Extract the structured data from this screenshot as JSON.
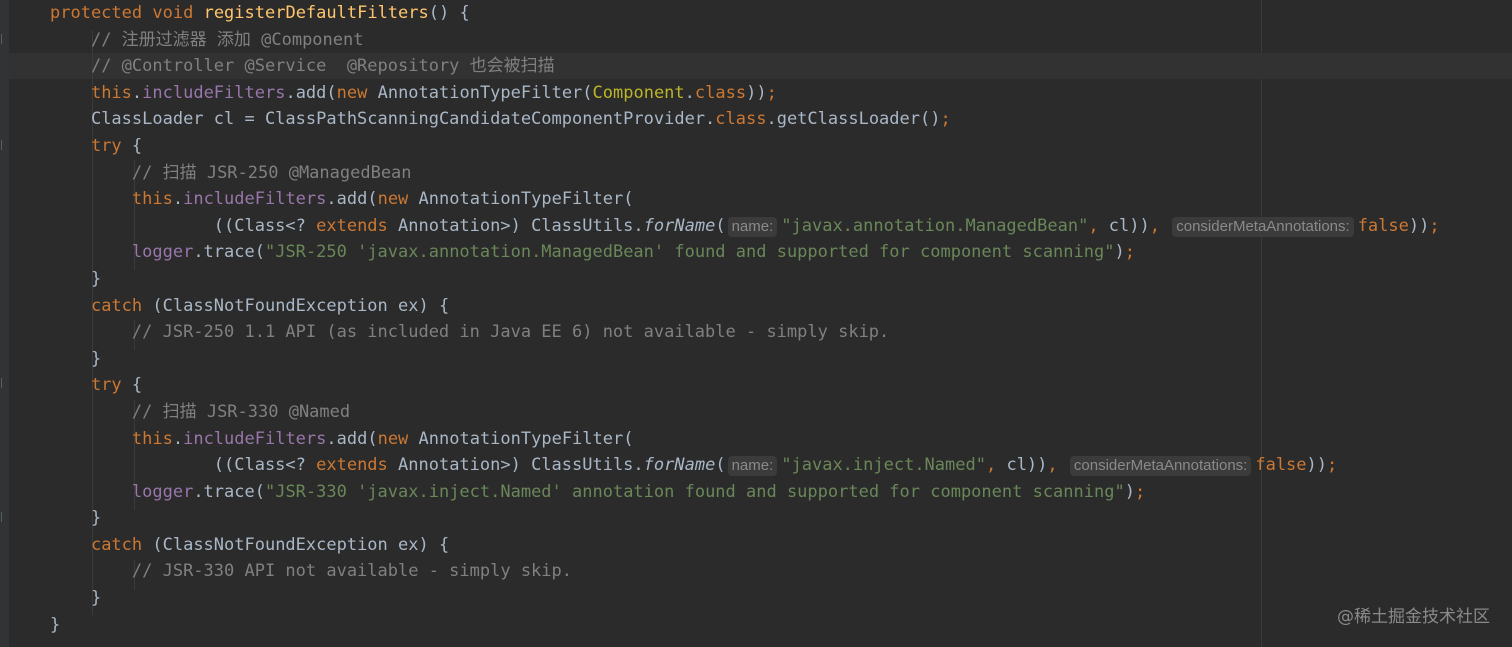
{
  "editor": {
    "method_signature": {
      "modifier": "protected",
      "return_type": "void",
      "name": "registerDefaultFilters",
      "open": "() {"
    },
    "comment1": "// 注册过滤器 添加 @Component",
    "comment2": "// @Controller @Service  @Repository 也会被扫描",
    "line4": {
      "this_kw": "this",
      "dot1": ".",
      "field": "includeFilters",
      "call": ".add(",
      "new_kw": "new",
      "ctor": " AnnotationTypeFilter(",
      "annot": "Component",
      "dot2": ".",
      "class_kw": "class",
      "close": "))",
      "semi": ";"
    },
    "line5": {
      "start": "ClassLoader cl = ClassPathScanningCandidateComponentProvider.",
      "class_kw": "class",
      "end": ".getClassLoader()",
      "semi": ";"
    },
    "try1": {
      "try_kw": "try",
      "brace": " {",
      "comment": "// 扫描 JSR-250 @ManagedBean",
      "this_kw": "this",
      "dot": ".",
      "field": "includeFilters",
      "call": ".add(",
      "new_kw": "new",
      "ctor": " AnnotationTypeFilter(",
      "cast_open": "((Class<? ",
      "extends_kw": "extends",
      "cast_close": " Annotation>) ClassUtils.",
      "for_name": "forName",
      "paren": "(",
      "hint_name": "name:",
      "string_arg": "\"javax.annotation.ManagedBean\"",
      "comma": ",",
      "cl_close": " cl))",
      "comma2": ",",
      "hint_meta": "considerMetaAnnotations:",
      "false_kw": "false",
      "end": "))",
      "semi": ";",
      "logger": "logger",
      "trace": ".trace(",
      "log_string": "\"JSR-250 'javax.annotation.ManagedBean' found and supported for component scanning\"",
      "log_end": ")",
      "log_semi": ";",
      "close": "}"
    },
    "catch1": {
      "catch_kw": "catch",
      "rest": " (ClassNotFoundException ex) {",
      "comment": "// JSR-250 1.1 API (as included in Java EE 6) not available - simply skip.",
      "close": "}"
    },
    "try2": {
      "try_kw": "try",
      "brace": " {",
      "comment": "// 扫描 JSR-330 @Named",
      "this_kw": "this",
      "dot": ".",
      "field": "includeFilters",
      "call": ".add(",
      "new_kw": "new",
      "ctor": " AnnotationTypeFilter(",
      "cast_open": "((Class<? ",
      "extends_kw": "extends",
      "cast_close": " Annotation>) ClassUtils.",
      "for_name": "forName",
      "paren": "(",
      "hint_name": "name:",
      "string_arg": "\"javax.inject.Named\"",
      "comma": ",",
      "cl_close": " cl))",
      "comma2": ",",
      "hint_meta": "considerMetaAnnotations:",
      "false_kw": "false",
      "end": "))",
      "semi": ";",
      "logger": "logger",
      "trace": ".trace(",
      "log_string": "\"JSR-330 'javax.inject.Named' annotation found and supported for component scanning\"",
      "log_end": ")",
      "log_semi": ";",
      "close": "}"
    },
    "catch2": {
      "catch_kw": "catch",
      "rest": " (ClassNotFoundException ex) {",
      "comment": "// JSR-330 API not available - simply skip.",
      "close": "}"
    },
    "method_close": "}"
  },
  "watermark": "@稀土掘金技术社区",
  "colors": {
    "background": "#2b2b2b",
    "keyword": "#cc7832",
    "method": "#ffc66d",
    "comment": "#808080",
    "field": "#9876aa",
    "string": "#6a8759",
    "annotation": "#bbb529",
    "text": "#a9b7c6"
  }
}
